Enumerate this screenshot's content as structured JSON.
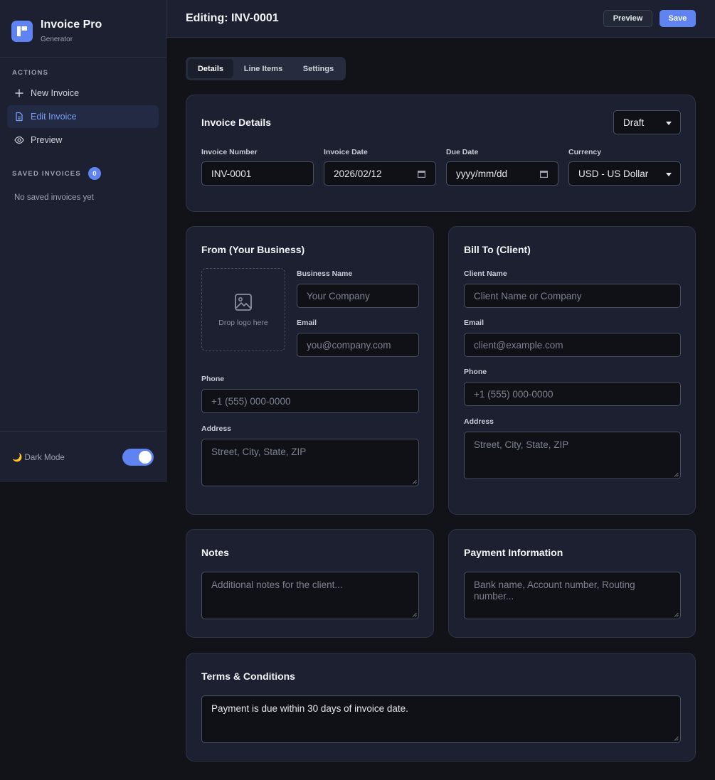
{
  "brand": {
    "title": "Invoice Pro",
    "subtitle": "Generator"
  },
  "sidebar": {
    "actions_label": "Actions",
    "items": [
      {
        "label": "New Invoice",
        "icon": "plus-icon",
        "active": false
      },
      {
        "label": "Edit Invoice",
        "icon": "document-icon",
        "active": true
      },
      {
        "label": "Preview",
        "icon": "eye-icon",
        "active": false
      }
    ],
    "saved_label": "Saved Invoices",
    "saved_count": "0",
    "saved_empty": "No saved invoices yet",
    "dark_mode_label": "🌙 Dark Mode",
    "dark_mode_on": true
  },
  "header": {
    "title": "Editing: INV-0001",
    "preview_label": "Preview",
    "save_label": "Save"
  },
  "tabs": [
    {
      "label": "Details",
      "active": true
    },
    {
      "label": "Line Items",
      "active": false
    },
    {
      "label": "Settings",
      "active": false
    }
  ],
  "invoice_details": {
    "title": "Invoice Details",
    "status": "Draft",
    "number_label": "Invoice Number",
    "number_value": "INV-0001",
    "date_label": "Invoice Date",
    "date_value": "2026/02/12",
    "due_label": "Due Date",
    "due_placeholder": "yyyy/mm/dd",
    "currency_label": "Currency",
    "currency_value": "USD - US Dollar"
  },
  "from": {
    "title": "From (Your Business)",
    "logo_text": "Drop logo here",
    "business_label": "Business Name",
    "business_placeholder": "Your Company",
    "email_label": "Email",
    "email_placeholder": "you@company.com",
    "phone_label": "Phone",
    "phone_placeholder": "+1 (555) 000-0000",
    "address_label": "Address",
    "address_placeholder": "Street, City, State, ZIP"
  },
  "bill_to": {
    "title": "Bill To (Client)",
    "client_label": "Client Name",
    "client_placeholder": "Client Name or Company",
    "email_label": "Email",
    "email_placeholder": "client@example.com",
    "phone_label": "Phone",
    "phone_placeholder": "+1 (555) 000-0000",
    "address_label": "Address",
    "address_placeholder": "Street, City, State, ZIP"
  },
  "notes": {
    "title": "Notes",
    "placeholder": "Additional notes for the client..."
  },
  "payment": {
    "title": "Payment Information",
    "placeholder": "Bank name, Account number, Routing number..."
  },
  "terms": {
    "title": "Terms & Conditions",
    "value": "Payment is due within 30 days of invoice date."
  },
  "colors": {
    "accent": "#5f84f2",
    "background": "#111318",
    "panel": "#1c2030",
    "input": "#0f1117"
  }
}
